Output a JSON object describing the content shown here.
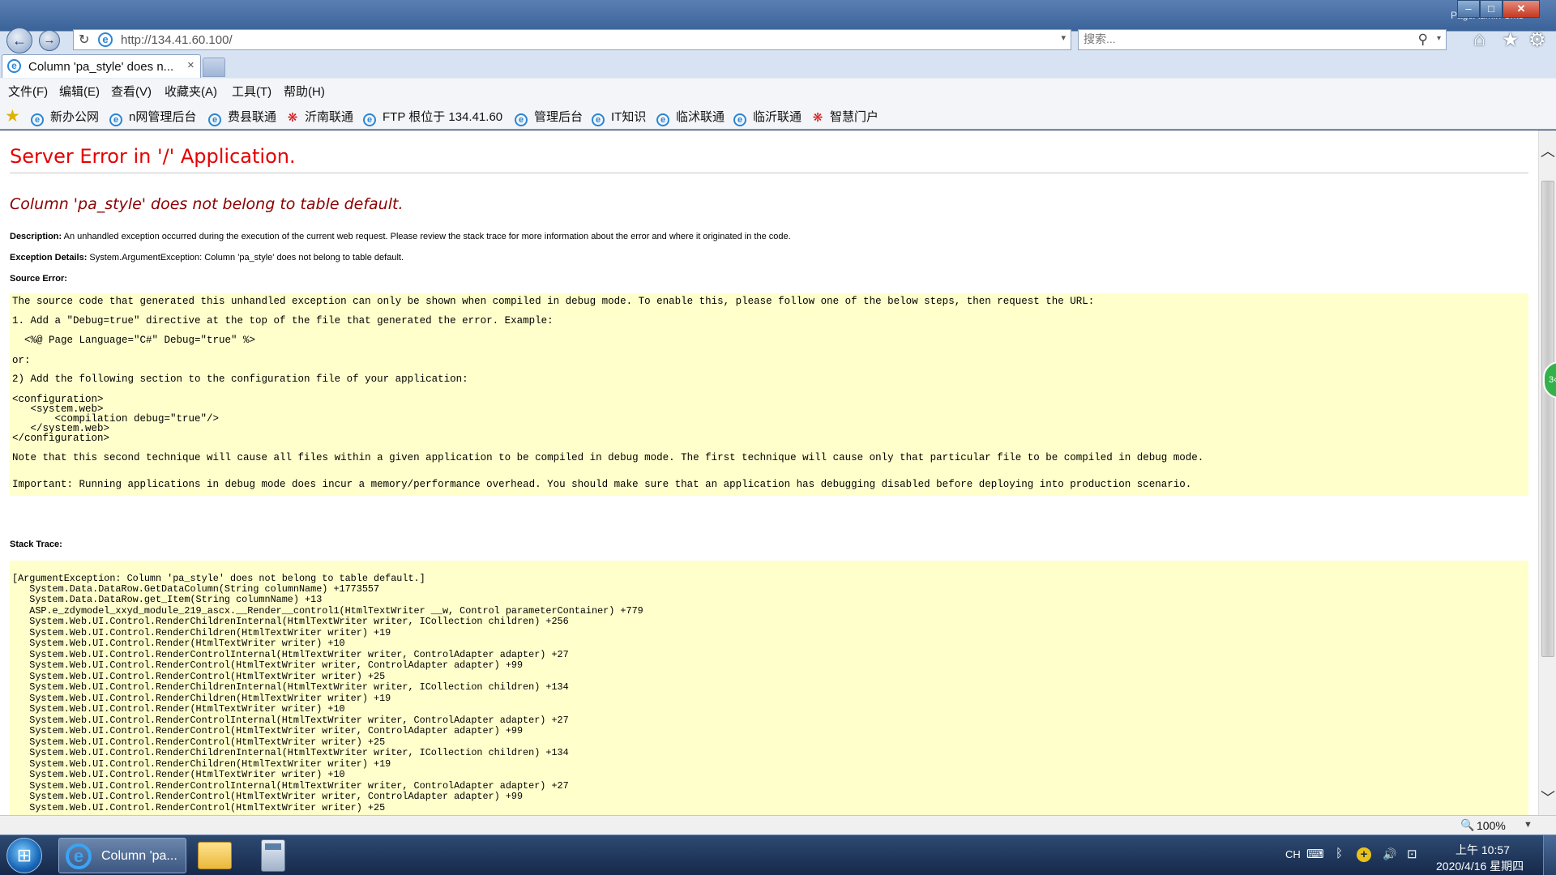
{
  "window": {
    "title": "PageAdmin Cms",
    "minimize_glyph": "–",
    "maximize_glyph": "□",
    "close_glyph": "✕"
  },
  "nav": {
    "back_glyph": "←",
    "forward_glyph": "→",
    "refresh_glyph": "↻",
    "url": "http://134.41.60.100/",
    "dropdown_glyph": "▾",
    "search_placeholder": "搜索...",
    "search_glyph": "⚲",
    "home_glyph": "⌂",
    "favorites_glyph": "★",
    "tools_glyph": "⚙",
    "ie_glyph": "e"
  },
  "tab": {
    "title": "Column 'pa_style' does n...",
    "close_glyph": "×"
  },
  "menu": [
    "文件(F)",
    "编辑(E)",
    "查看(V)",
    "收藏夹(A)",
    "工具(T)",
    "帮助(H)"
  ],
  "favorites": {
    "star_glyph": "★",
    "items": [
      {
        "label": "新办公网",
        "icon": "ie"
      },
      {
        "label": "n网管理后台",
        "icon": "ie"
      },
      {
        "label": "费县联通",
        "icon": "ie"
      },
      {
        "label": "沂南联通",
        "icon": "unicom"
      },
      {
        "label": "FTP 根位于 134.41.60",
        "icon": "ie"
      },
      {
        "label": "管理后台",
        "icon": "ie"
      },
      {
        "label": "IT知识",
        "icon": "ie"
      },
      {
        "label": "临沭联通",
        "icon": "ie"
      },
      {
        "label": "临沂联通",
        "icon": "ie"
      },
      {
        "label": "智慧门户",
        "icon": "unicom"
      }
    ]
  },
  "page": {
    "heading": "Server Error in '/' Application.",
    "error_title": "Column 'pa_style' does not belong to table default.",
    "description_label": "Description:",
    "description_text": "An unhandled exception occurred during the execution of the current web request. Please review the stack trace for more information about the error and where it originated in the code.",
    "exception_label": "Exception Details:",
    "exception_text": "System.ArgumentException: Column 'pa_style' does not belong to table default.",
    "source_error_label": "Source Error:",
    "source_lines": [
      "The source code that generated this unhandled exception can only be shown when compiled in debug mode. To enable this, please follow one of the below steps, then request the URL:",
      "1. Add a \"Debug=true\" directive at the top of the file that generated the error. Example:",
      "  <%@ Page Language=\"C#\" Debug=\"true\" %>",
      "or:",
      "2) Add the following section to the configuration file of your application:",
      "<configuration>",
      "   <system.web>",
      "       <compilation debug=\"true\"/>",
      "   </system.web>",
      "</configuration>",
      "Note that this second technique will cause all files within a given application to be compiled in debug mode. The first technique will cause only that particular file to be compiled in debug mode.",
      "Important: Running applications in debug mode does incur a memory/performance overhead. You should make sure that an application has debugging disabled before deploying into production scenario."
    ],
    "stack_trace_label": "Stack Trace:",
    "stack_lines": [
      "[ArgumentException: Column 'pa_style' does not belong to table default.]",
      "   System.Data.DataRow.GetDataColumn(String columnName) +1773557",
      "   System.Data.DataRow.get_Item(String columnName) +13",
      "   ASP.e_zdymodel_xxyd_module_219_ascx.__Render__control1(HtmlTextWriter __w, Control parameterContainer) +779",
      "   System.Web.UI.Control.RenderChildrenInternal(HtmlTextWriter writer, ICollection children) +256",
      "   System.Web.UI.Control.RenderChildren(HtmlTextWriter writer) +19",
      "   System.Web.UI.Control.Render(HtmlTextWriter writer) +10",
      "   System.Web.UI.Control.RenderControlInternal(HtmlTextWriter writer, ControlAdapter adapter) +27",
      "   System.Web.UI.Control.RenderControl(HtmlTextWriter writer, ControlAdapter adapter) +99",
      "   System.Web.UI.Control.RenderControl(HtmlTextWriter writer) +25",
      "   System.Web.UI.Control.RenderChildrenInternal(HtmlTextWriter writer, ICollection children) +134",
      "   System.Web.UI.Control.RenderChildren(HtmlTextWriter writer) +19",
      "   System.Web.UI.Control.Render(HtmlTextWriter writer) +10",
      "   System.Web.UI.Control.RenderControlInternal(HtmlTextWriter writer, ControlAdapter adapter) +27",
      "   System.Web.UI.Control.RenderControl(HtmlTextWriter writer, ControlAdapter adapter) +99",
      "   System.Web.UI.Control.RenderControl(HtmlTextWriter writer) +25",
      "   System.Web.UI.Control.RenderChildrenInternal(HtmlTextWriter writer, ICollection children) +134",
      "   System.Web.UI.Control.RenderChildren(HtmlTextWriter writer) +19",
      "   System.Web.UI.Control.Render(HtmlTextWriter writer) +10",
      "   System.Web.UI.Control.RenderControlInternal(HtmlTextWriter writer, ControlAdapter adapter) +27",
      "   System.Web.UI.Control.RenderControl(HtmlTextWriter writer, ControlAdapter adapter) +99",
      "   System.Web.UI.Control.RenderControl(HtmlTextWriter writer) +25"
    ]
  },
  "scroll": {
    "up_glyph": "︿",
    "down_glyph": "﹀"
  },
  "side_badge": "3‹",
  "status": {
    "zoom_glyph": "🔍",
    "zoom": "100%",
    "zoom_drop": "▼"
  },
  "taskbar": {
    "start_glyph": "⊞",
    "ie_task_label": "Column 'pa...",
    "tray_lang": "CH",
    "tray_keyboard": "⌨",
    "tray_bluetooth": "ᛒ",
    "tray_plus": "+",
    "tray_volume": "🔊",
    "tray_network": "⊡",
    "time": "上午 10:57",
    "date": "2020/4/16 星期四"
  },
  "colors": {
    "error_heading": "#e40000",
    "error_title": "#8b0000",
    "source_box": "#ffffcc"
  }
}
